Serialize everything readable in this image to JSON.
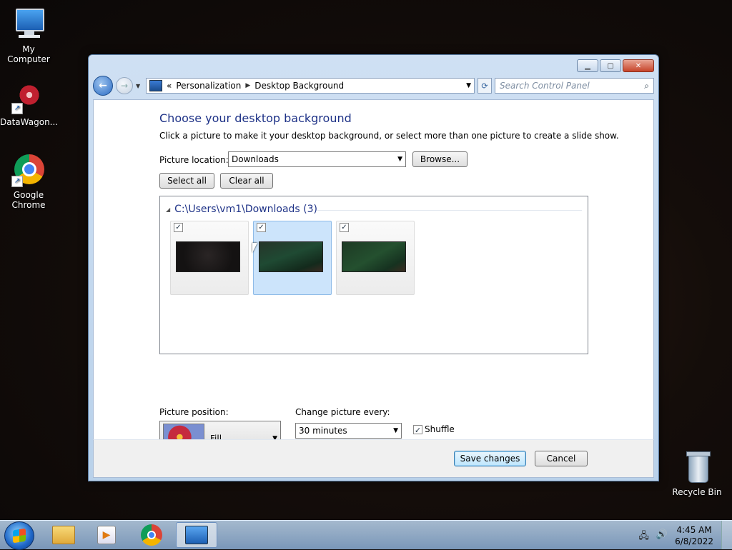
{
  "desktop": {
    "icons": [
      {
        "label": "My Computer"
      },
      {
        "label": "DataWagon..."
      },
      {
        "label": "Google Chrome"
      },
      {
        "label": "Recycle Bin"
      }
    ]
  },
  "window": {
    "breadcrumb": [
      "Personalization",
      "Desktop Background"
    ],
    "breadcrumb_prefix": "«",
    "search_placeholder": "Search Control Panel",
    "heading": "Choose your desktop background",
    "description": "Click a picture to make it your desktop background, or select more than one picture to create a slide show.",
    "picture_location_label": "Picture location:",
    "picture_location_value": "Downloads",
    "browse_label": "Browse...",
    "select_all_label": "Select all",
    "clear_all_label": "Clear all",
    "gallery": {
      "group_title": "C:\\Users\\vm1\\Downloads (3)",
      "thumbnails": [
        {
          "checked": true,
          "selected": false
        },
        {
          "checked": true,
          "selected": true
        },
        {
          "checked": true,
          "selected": false
        }
      ]
    },
    "picture_position_label": "Picture position:",
    "picture_position_value": "Fill",
    "change_every_label": "Change picture every:",
    "change_every_value": "30 minutes",
    "shuffle_label": "Shuffle",
    "shuffle_checked": true,
    "save_label": "Save changes",
    "cancel_label": "Cancel"
  },
  "taskbar": {
    "clock_time": "4:45 AM",
    "clock_date": "6/8/2022"
  }
}
